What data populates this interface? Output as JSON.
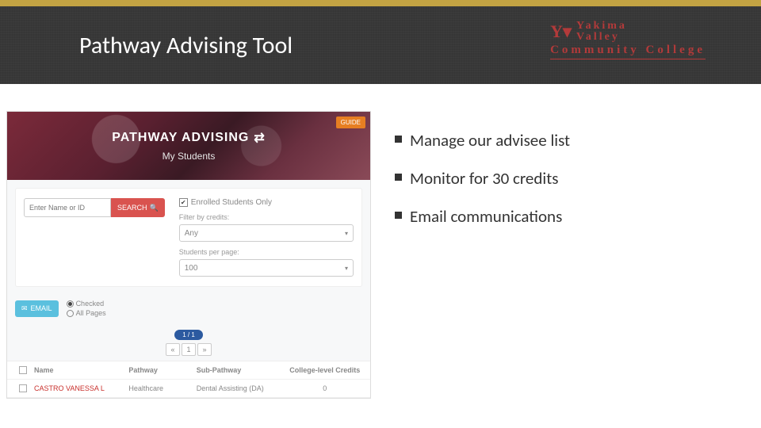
{
  "slide": {
    "title": "Pathway Advising Tool"
  },
  "logo": {
    "line1": "Yakima",
    "line2": "Valley",
    "line3": "Community",
    "line4": "College"
  },
  "app": {
    "banner_title": "PATHWAY ADVISING",
    "banner_subtitle": "My Students",
    "guide_label": "GUIDE",
    "search_placeholder": "Enter Name or ID",
    "search_button": "SEARCH",
    "enrolled_only_label": "Enrolled Students Only",
    "filter_credits_label": "Filter by credits:",
    "filter_credits_value": "Any",
    "per_page_label": "Students per page:",
    "per_page_value": "100",
    "email_button": "EMAIL",
    "radio_checked": "Checked",
    "radio_all": "All Pages",
    "page_indicator": "1 / 1",
    "pager_prev": "«",
    "pager_page": "1",
    "pager_next": "»",
    "columns": {
      "name": "Name",
      "pathway": "Pathway",
      "subpathway": "Sub-Pathway",
      "credits": "College-level Credits"
    },
    "row": {
      "name": "CASTRO VANESSA L",
      "pathway": "Healthcare",
      "subpathway": "Dental Assisting (DA)",
      "credits": "0"
    }
  },
  "bullets": {
    "b1": "Manage our advisee list",
    "b2": "Monitor for 30 credits",
    "b3": "Email communications"
  }
}
